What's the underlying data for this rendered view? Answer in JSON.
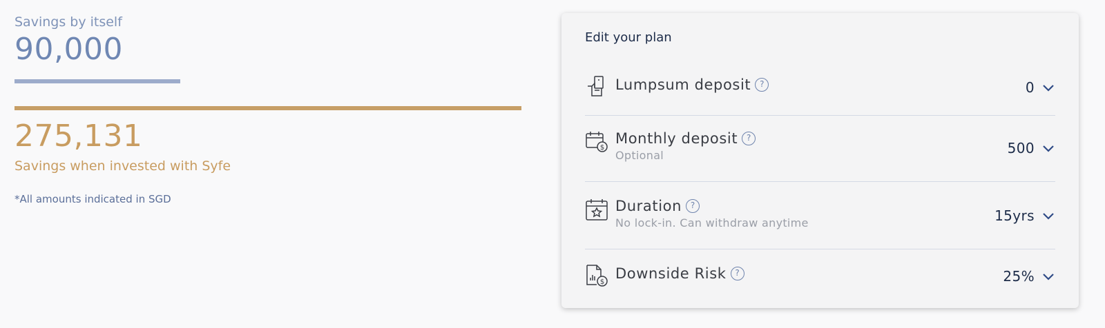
{
  "summary": {
    "self_label": "Savings by itself",
    "self_value": "90,000",
    "invest_value": "275,131",
    "invest_label": "Savings when invested with Syfe",
    "note": "*All amounts indicated in SGD",
    "self_bar_fraction": 0.327
  },
  "plan": {
    "title": "Edit your plan",
    "rows": [
      {
        "label": "Lumpsum deposit",
        "sub": "",
        "value": "0",
        "icon": "hand-money-icon"
      },
      {
        "label": "Monthly deposit",
        "sub": "Optional",
        "value": "500",
        "icon": "calendar-dollar-icon"
      },
      {
        "label": "Duration",
        "sub": "No lock-in. Can withdraw anytime",
        "value": "15yrs",
        "icon": "calendar-star-icon"
      },
      {
        "label": "Downside Risk",
        "sub": "",
        "value": "25%",
        "icon": "document-dollar-icon"
      }
    ],
    "help_glyph": "?"
  },
  "colors": {
    "self": "#6f87b3",
    "invest": "#c89c60",
    "chevron": "#2e4a86"
  }
}
